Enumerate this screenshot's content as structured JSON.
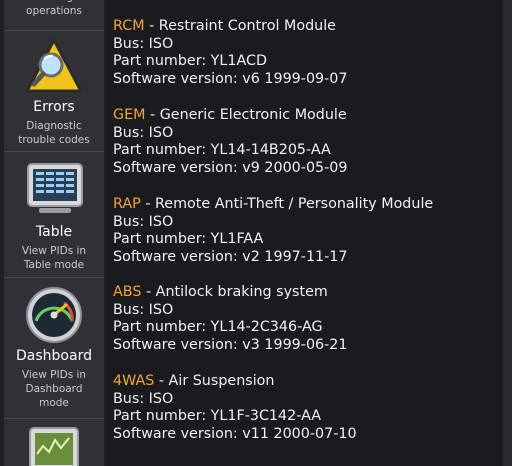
{
  "sidebar": {
    "items": [
      {
        "title": "",
        "desc": "Check log of\noperations",
        "icon": "log-icon"
      },
      {
        "title": "Errors",
        "desc": "Diagnostic\ntrouble codes",
        "icon": "warning-magnifier-icon"
      },
      {
        "title": "Table",
        "desc": "View PIDs in\nTable mode",
        "icon": "table-monitor-icon"
      },
      {
        "title": "Dashboard",
        "desc": "View PIDs in\nDashboard\nmode",
        "icon": "gauge-icon"
      },
      {
        "title": "",
        "desc": "",
        "icon": "chart-monitor-icon"
      }
    ]
  },
  "modules": [
    {
      "code": "RCM",
      "name": " - Restraint Control Module",
      "bus": "Bus: ISO",
      "part": "Part number: YL1ACD",
      "software": "Software version: v6 1999-09-07"
    },
    {
      "code": "GEM",
      "name": " - Generic Electronic Module",
      "bus": "Bus: ISO",
      "part": "Part number: YL14-14B205-AA",
      "software": "Software version: v9 2000-05-09"
    },
    {
      "code": "RAP",
      "name": " - Remote Anti-Theft / Personality Module",
      "bus": "Bus: ISO",
      "part": "Part number: YL1FAA",
      "software": "Software version: v2 1997-11-17"
    },
    {
      "code": "ABS",
      "name": " - Antilock braking system",
      "bus": "Bus: ISO",
      "part": "Part number: YL14-2C346-AG",
      "software": "Software version: v3 1999-06-21"
    },
    {
      "code": "4WAS",
      "name": " - Air Suspension",
      "bus": "Bus: ISO",
      "part": "Part number: YL1F-3C142-AA",
      "software": "Software version: v11 2000-07-10"
    }
  ],
  "colors": {
    "accent": "#f2a535",
    "text": "#f2f2f2",
    "sidebar_bg": "#2f3135",
    "content_bg": "#1a1b1e"
  }
}
